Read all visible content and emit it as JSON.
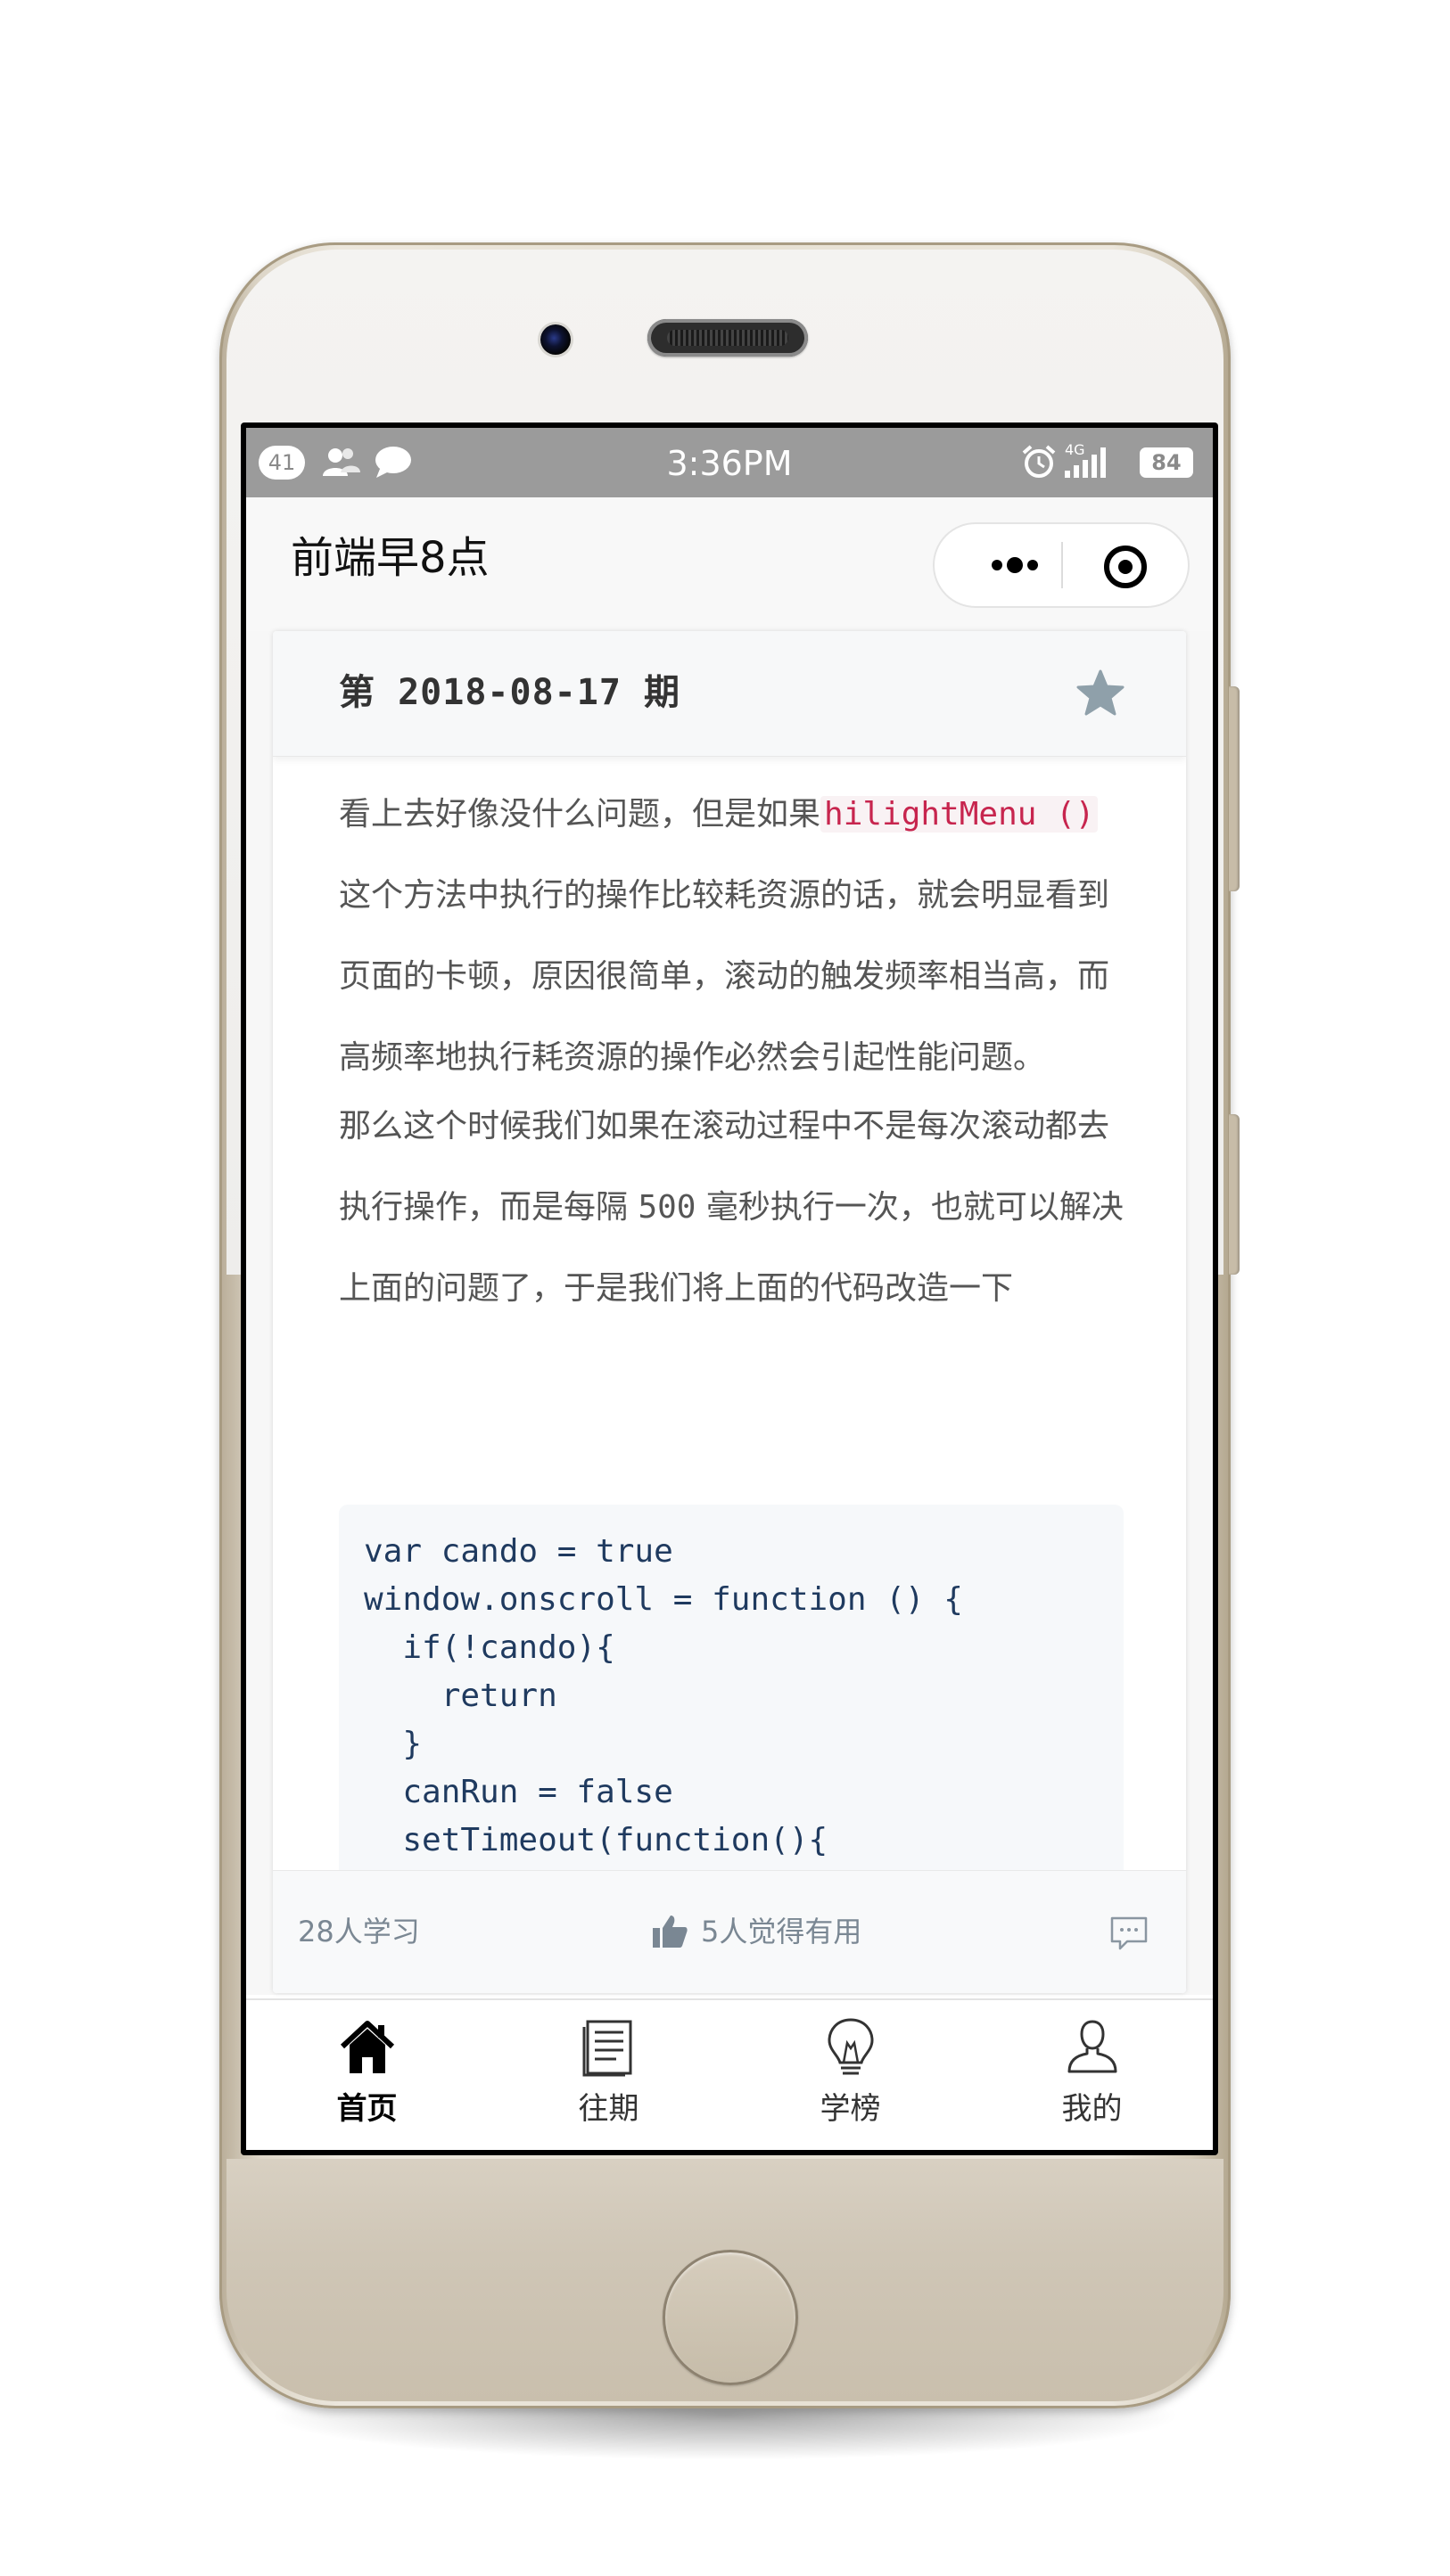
{
  "status_bar": {
    "notification_count": "41",
    "time": "3:36PM",
    "network": "4G",
    "battery": "84"
  },
  "nav": {
    "title": "前端早8点"
  },
  "issue": {
    "title": "第 2018-08-17 期"
  },
  "article": {
    "p1_before": "看上去好像没什么问题，但是如果",
    "p1_code": "hilightMenu ()",
    "p1_after": " 这个方法中执行的操作比较耗资源的话，就会明显看到页面的卡顿，原因很简单，滚动的触发频率相当高，而高频率地执行耗资源的操作必然会引起性能问题。",
    "p2_before": "那么这个时候我们如果在滚动过程中不是每次滚动都去执行操作，而是每隔 ",
    "p2_number": "500",
    "p2_after": " 毫秒执行一次，也就可以解决上面的问题了，于是我们将上面的代码改造一下",
    "code": "var cando = true\nwindow.onscroll = function () {\n  if(!cando){\n    return\n  }\n  canRun = false\n  setTimeout(function(){"
  },
  "footer": {
    "learners": "28人学习",
    "useful": "5人觉得有用"
  },
  "tabs": [
    {
      "label": "首页",
      "icon": "home-icon",
      "active": true
    },
    {
      "label": "往期",
      "icon": "document-icon",
      "active": false
    },
    {
      "label": "学榜",
      "icon": "lightbulb-icon",
      "active": false
    },
    {
      "label": "我的",
      "icon": "user-icon",
      "active": false
    }
  ],
  "colors": {
    "status_bar": "#9b9b9b",
    "inline_code": "#c7254e",
    "code_text": "#1f3a5f",
    "star": "#8fa0aa",
    "muted": "#7a8793"
  }
}
